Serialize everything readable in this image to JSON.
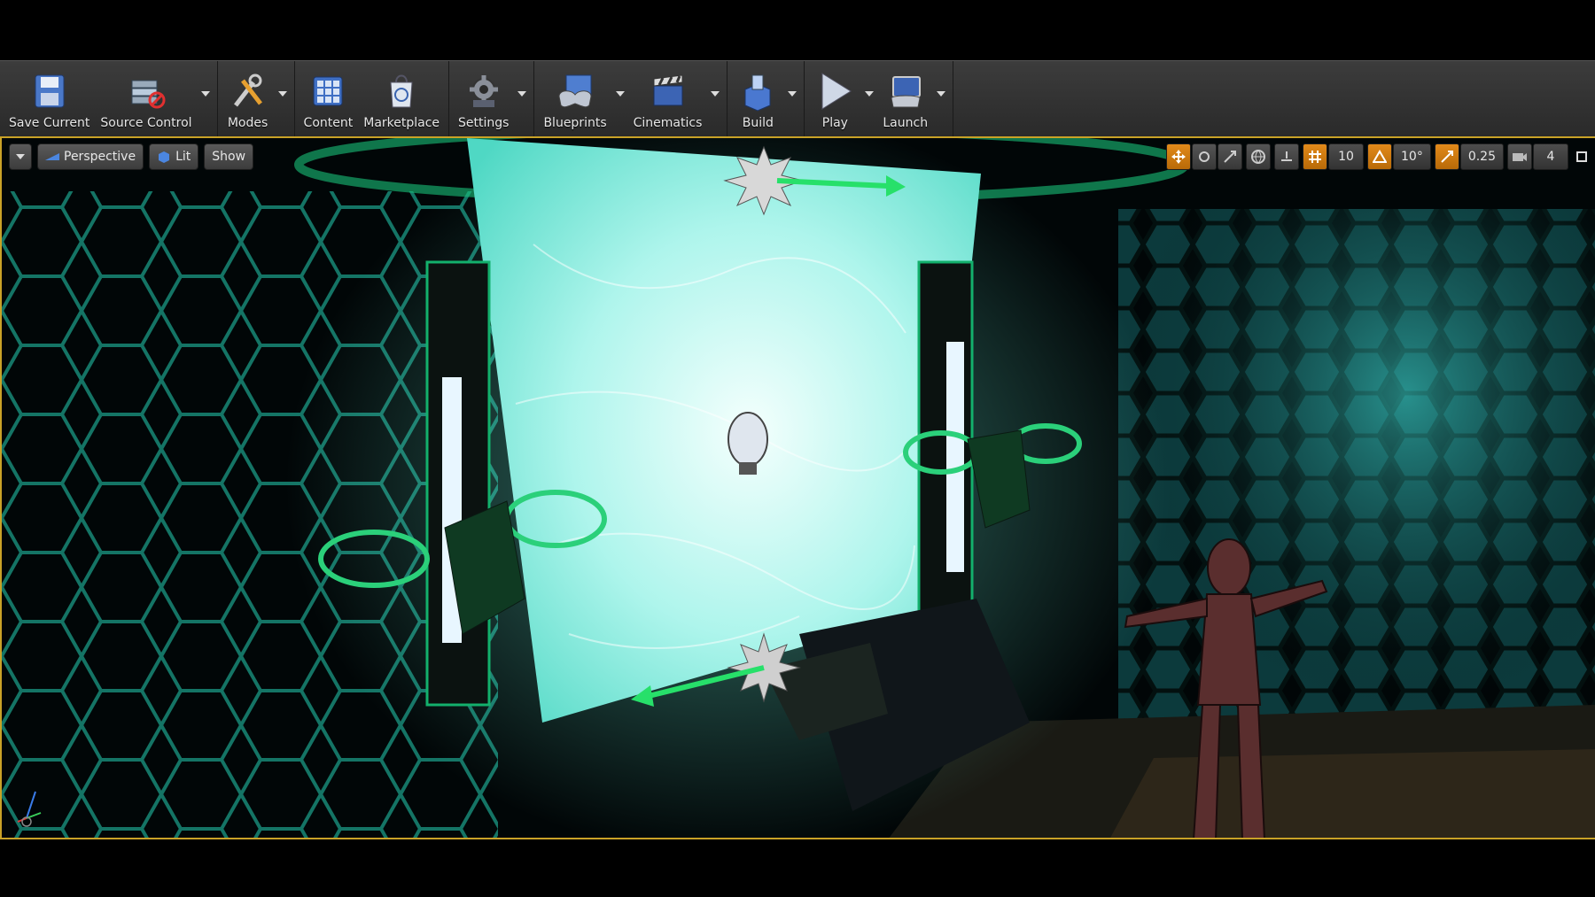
{
  "toolbar": {
    "buttons": [
      {
        "label": "Save Current",
        "icon": "save-icon"
      },
      {
        "label": "Source Control",
        "icon": "source-control-icon"
      },
      {
        "label": "Modes",
        "icon": "modes-icon"
      },
      {
        "label": "Content",
        "icon": "content-icon"
      },
      {
        "label": "Marketplace",
        "icon": "marketplace-icon"
      },
      {
        "label": "Settings",
        "icon": "settings-icon"
      },
      {
        "label": "Blueprints",
        "icon": "blueprints-icon"
      },
      {
        "label": "Cinematics",
        "icon": "cinematics-icon"
      },
      {
        "label": "Build",
        "icon": "build-icon"
      },
      {
        "label": "Play",
        "icon": "play-icon"
      },
      {
        "label": "Launch",
        "icon": "launch-icon"
      }
    ]
  },
  "viewport": {
    "view_mode": "Perspective",
    "lighting": "Lit",
    "show": "Show",
    "grid_snap": "10",
    "rotation_snap": "10°",
    "scale_snap": "0.25",
    "camera_speed": "4"
  },
  "colors": {
    "accent": "#c9a227",
    "portal": "#7ff5e0",
    "hex_glow": "#2fe0c0",
    "gizmo_arrow": "#27e06a"
  }
}
